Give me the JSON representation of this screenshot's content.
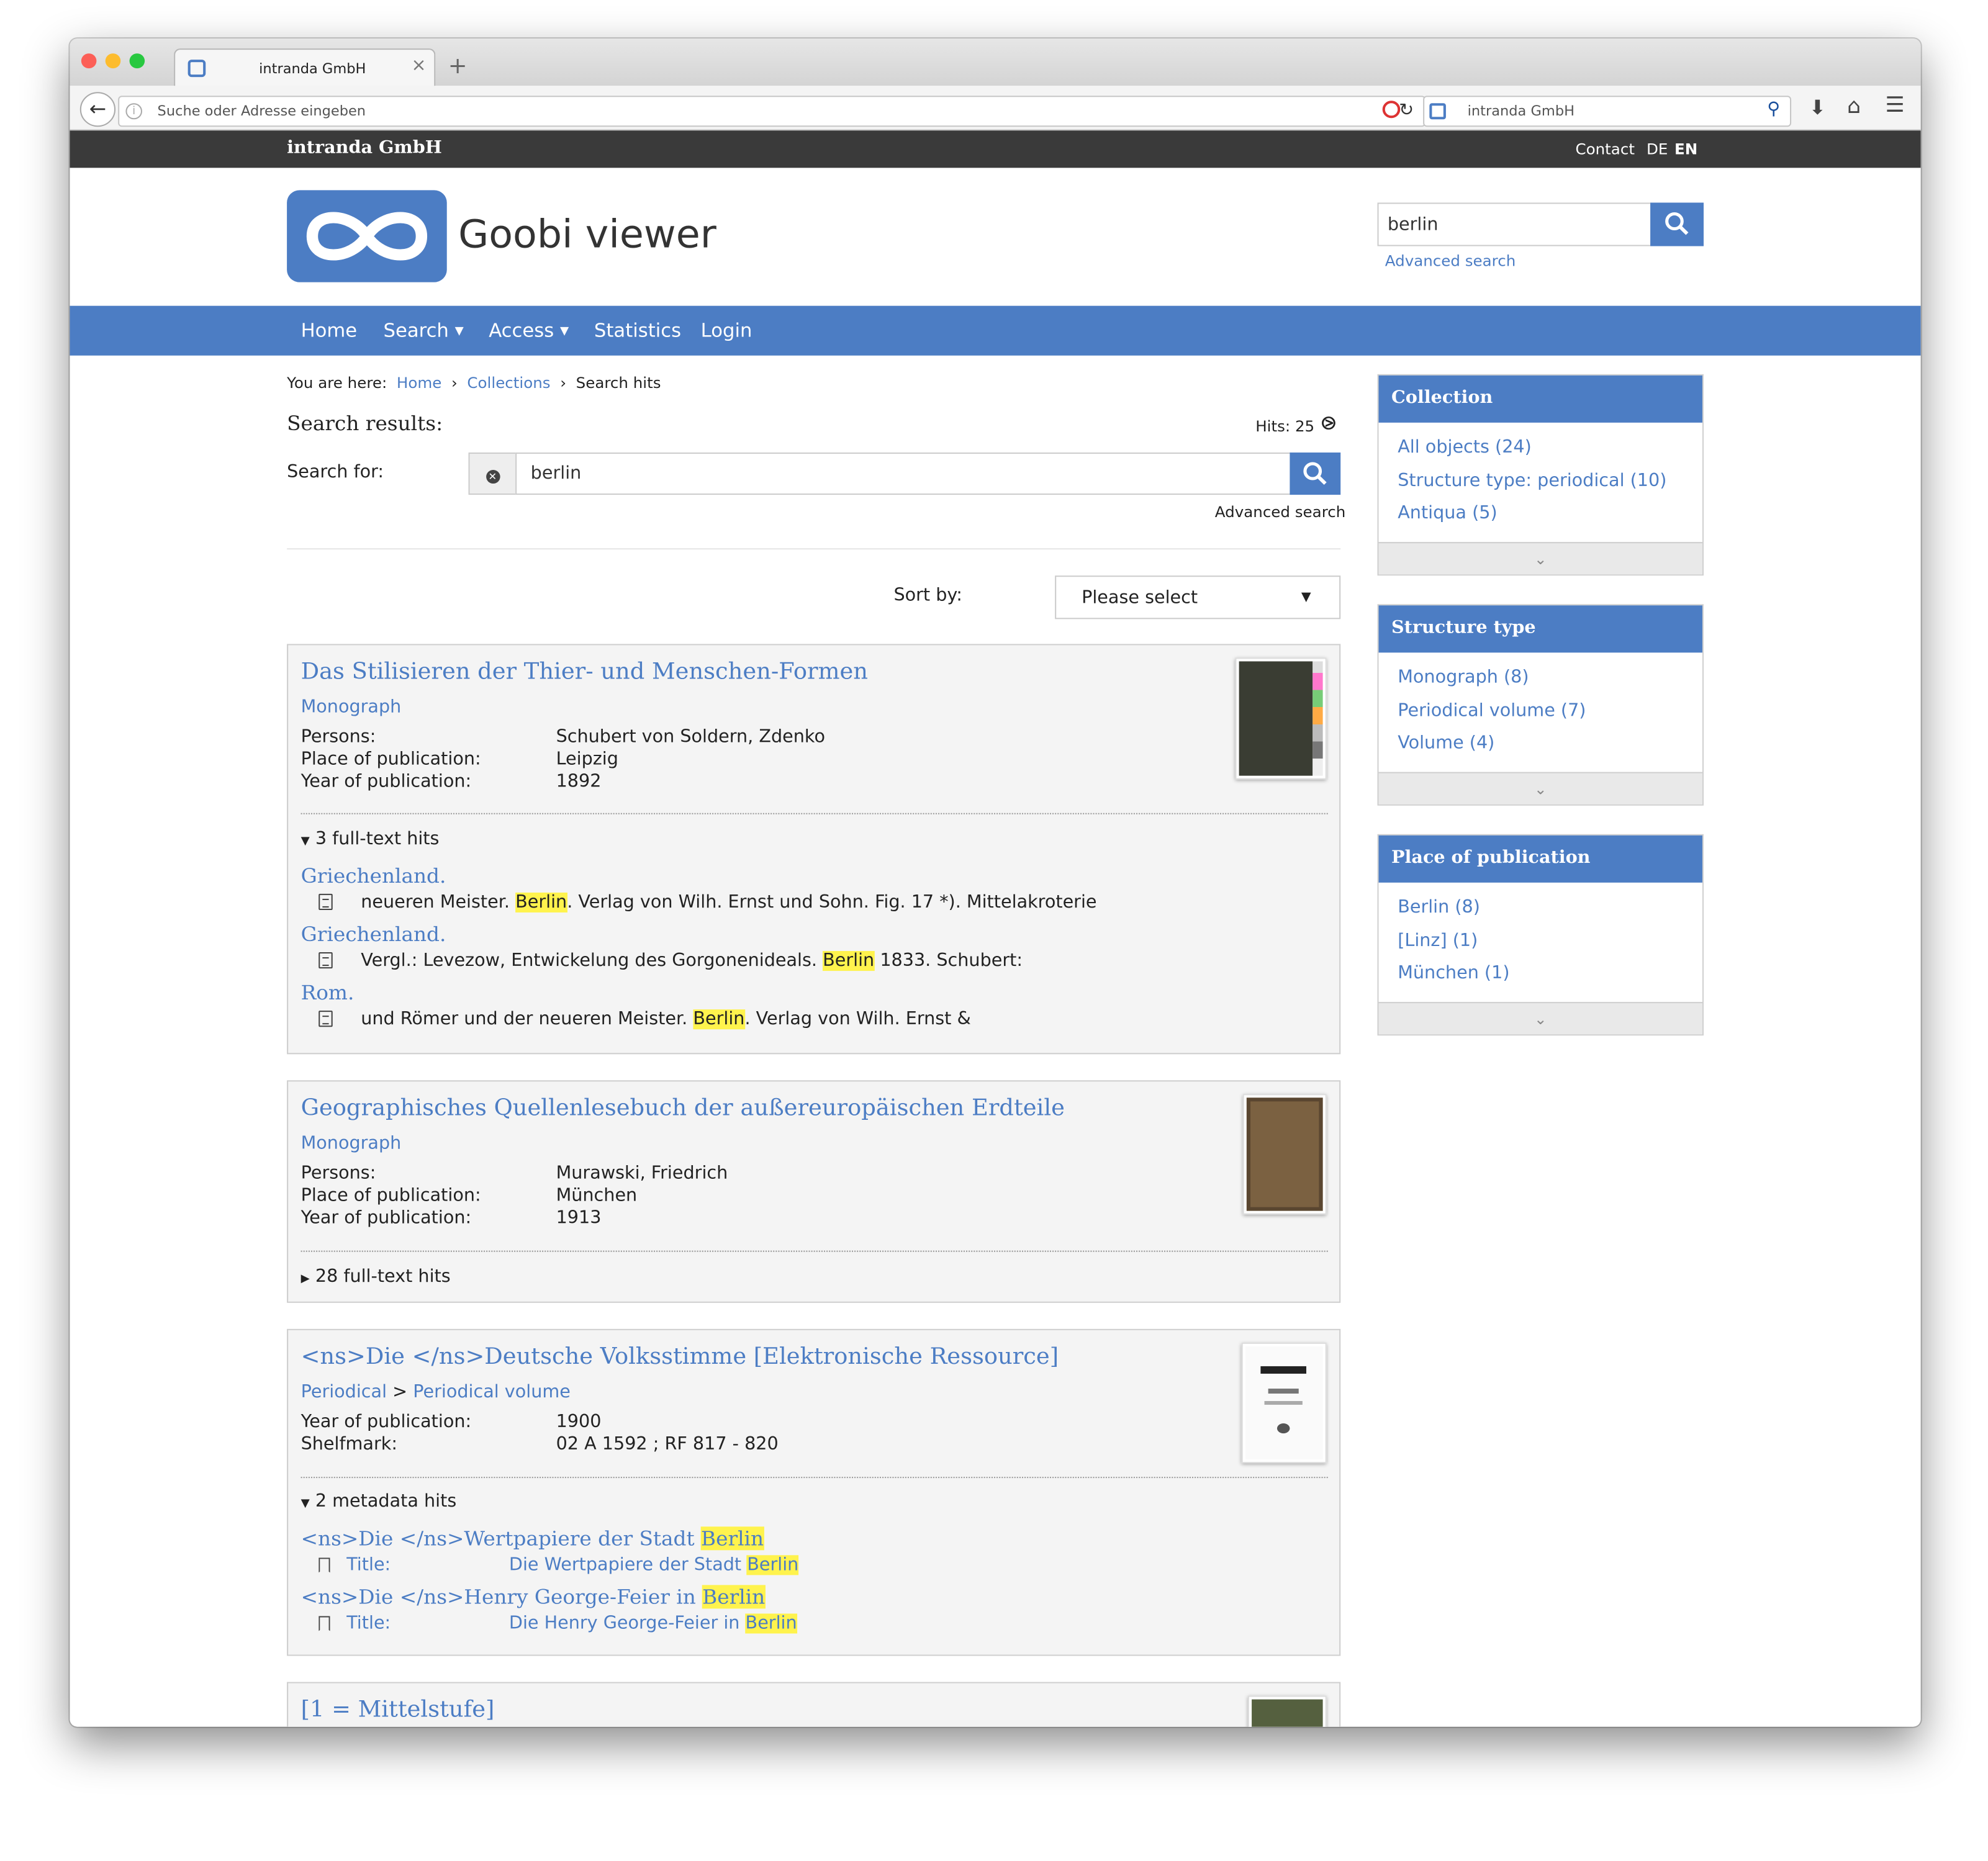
{
  "browser": {
    "tab_title": "intranda GmbH",
    "tab_close": "×",
    "new_tab": "+",
    "url_placeholder": "Suche oder Adresse eingeben",
    "search_engine_text": "intranda GmbH"
  },
  "topbar": {
    "brand": "intranda GmbH",
    "contact": "Contact",
    "lang_de": "DE",
    "lang_en": "EN"
  },
  "header": {
    "logo_text": "Goobi viewer",
    "search_value": "berlin",
    "advanced_search": "Advanced search"
  },
  "nav": {
    "items": [
      "Home",
      "Search",
      "Access",
      "Statistics",
      "Login"
    ]
  },
  "breadcrumb": {
    "prefix": "You are here:",
    "home": "Home",
    "collections": "Collections",
    "current": "Search hits",
    "sep": "›"
  },
  "results": {
    "heading": "Search results:",
    "hits_label": "Hits: 25",
    "search_for_label": "Search for:",
    "query": "berlin",
    "advanced_search": "Advanced search",
    "sort_label": "Sort by:",
    "sort_value": "Please select"
  },
  "hit1": {
    "title": "Das Stilisieren der Thier- und Menschen-Formen",
    "type": "Monograph",
    "meta": [
      [
        "Persons:",
        "Schubert von Soldern, Zdenko"
      ],
      [
        "Place of publication:",
        "Leipzig"
      ],
      [
        "Year of publication:",
        "1892"
      ]
    ],
    "fulltext_toggle": "3 full-text hits",
    "snippets": [
      {
        "page": "Griechenland.",
        "pre": "neueren Meister. ",
        "hl": "Berlin",
        "post": ". Verlag von Wilh. Ernst und Sohn. Fig. 17 *). Mittelakroterie"
      },
      {
        "page": "Griechenland.",
        "pre": "Vergl.: Levezow, Entwickelung des Gorgonenideals. ",
        "hl": "Berlin",
        "post": " 1833. Schubert:"
      },
      {
        "page": "Rom.",
        "pre": "und Römer und der neueren Meister. ",
        "hl": "Berlin",
        "post": ". Verlag von Wilh. Ernst &"
      }
    ]
  },
  "hit2": {
    "title": "Geographisches Quellenlesebuch der außereuropäischen Erdteile",
    "type": "Monograph",
    "meta": [
      [
        "Persons:",
        "Murawski, Friedrich"
      ],
      [
        "Place of publication:",
        "München"
      ],
      [
        "Year of publication:",
        "1913"
      ]
    ],
    "fulltext_toggle": "28 full-text hits"
  },
  "hit3": {
    "title": "<ns>Die </ns>Deutsche Volksstimme [Elektronische Ressource]",
    "type_parent": "Periodical",
    "type_sep": ">",
    "type_child": "Periodical volume",
    "meta": [
      [
        "Year of publication:",
        "1900"
      ],
      [
        "Shelfmark:",
        "02 A 1592 ; RF 817 - 820"
      ]
    ],
    "metadata_toggle": "2 metadata hits",
    "subhits": [
      {
        "title_pre": "<ns>Die </ns>Wertpapiere der Stadt ",
        "title_hl": "Berlin",
        "label": "Title:",
        "value_pre": "Die Wertpapiere der Stadt ",
        "value_hl": "Berlin"
      },
      {
        "title_pre": "<ns>Die </ns>Henry George-Feier in ",
        "title_hl": "Berlin",
        "label": "Title:",
        "value_pre": "Die Henry George-Feier in ",
        "value_hl": "Berlin"
      }
    ]
  },
  "hit4": {
    "title": "[1 = Mittelstufe]"
  },
  "facets": {
    "collection": {
      "title": "Collection",
      "items": [
        "All objects (24)",
        "Structure type: periodical (10)",
        "Antiqua (5)"
      ]
    },
    "structure": {
      "title": "Structure type",
      "items": [
        "Monograph (8)",
        "Periodical volume (7)",
        "Volume (4)"
      ]
    },
    "place": {
      "title": "Place of publication",
      "items": [
        "Berlin (8)",
        "[Linz] (1)",
        "München (1)"
      ]
    }
  },
  "colors": {
    "accent": "#4c7dc4",
    "highlight": "#fff34d",
    "topbar": "#3a3a3a"
  }
}
